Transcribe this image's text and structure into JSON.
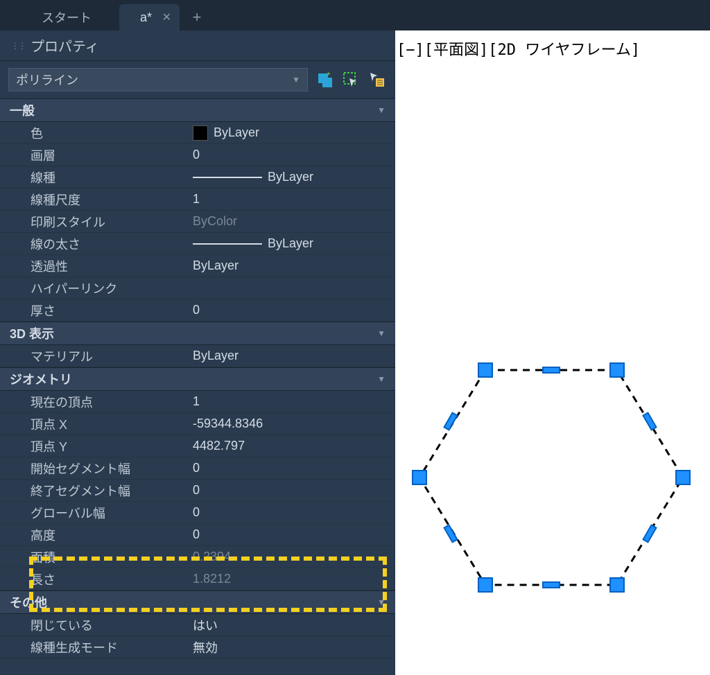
{
  "tabs": {
    "start": "スタート",
    "active": "a*"
  },
  "panel_title": "プロパティ",
  "selector": "ポリライン",
  "sections": {
    "general": {
      "title": "一般",
      "color_label": "色",
      "color_value": "ByLayer",
      "layer_label": "画層",
      "layer_value": "0",
      "linetype_label": "線種",
      "linetype_value": "ByLayer",
      "linetypescale_label": "線種尺度",
      "linetypescale_value": "1",
      "plotstyle_label": "印刷スタイル",
      "plotstyle_value": "ByColor",
      "lineweight_label": "線の太さ",
      "lineweight_value": "ByLayer",
      "transparency_label": "透過性",
      "transparency_value": "ByLayer",
      "hyperlink_label": "ハイパーリンク",
      "hyperlink_value": "",
      "thickness_label": "厚さ",
      "thickness_value": "0"
    },
    "view3d": {
      "title": "3D 表示",
      "material_label": "マテリアル",
      "material_value": "ByLayer"
    },
    "geometry": {
      "title": "ジオメトリ",
      "current_vertex_label": "現在の頂点",
      "current_vertex_value": "1",
      "vertex_x_label": "頂点 X",
      "vertex_x_value": "-59344.8346",
      "vertex_y_label": "頂点 Y",
      "vertex_y_value": "4482.797",
      "start_seg_width_label": "開始セグメント幅",
      "start_seg_width_value": "0",
      "end_seg_width_label": "終了セグメント幅",
      "end_seg_width_value": "0",
      "global_width_label": "グローバル幅",
      "global_width_value": "0",
      "elevation_label": "高度",
      "elevation_value": "0",
      "area_label": "面積",
      "area_value": "0.2394",
      "length_label": "長さ",
      "length_value": "1.8212"
    },
    "other": {
      "title": "その他",
      "closed_label": "閉じている",
      "closed_value": "はい",
      "ltgen_label": "線種生成モード",
      "ltgen_value": "無効"
    }
  },
  "viewport_label": "[−][平面図][2D ワイヤフレーム]"
}
